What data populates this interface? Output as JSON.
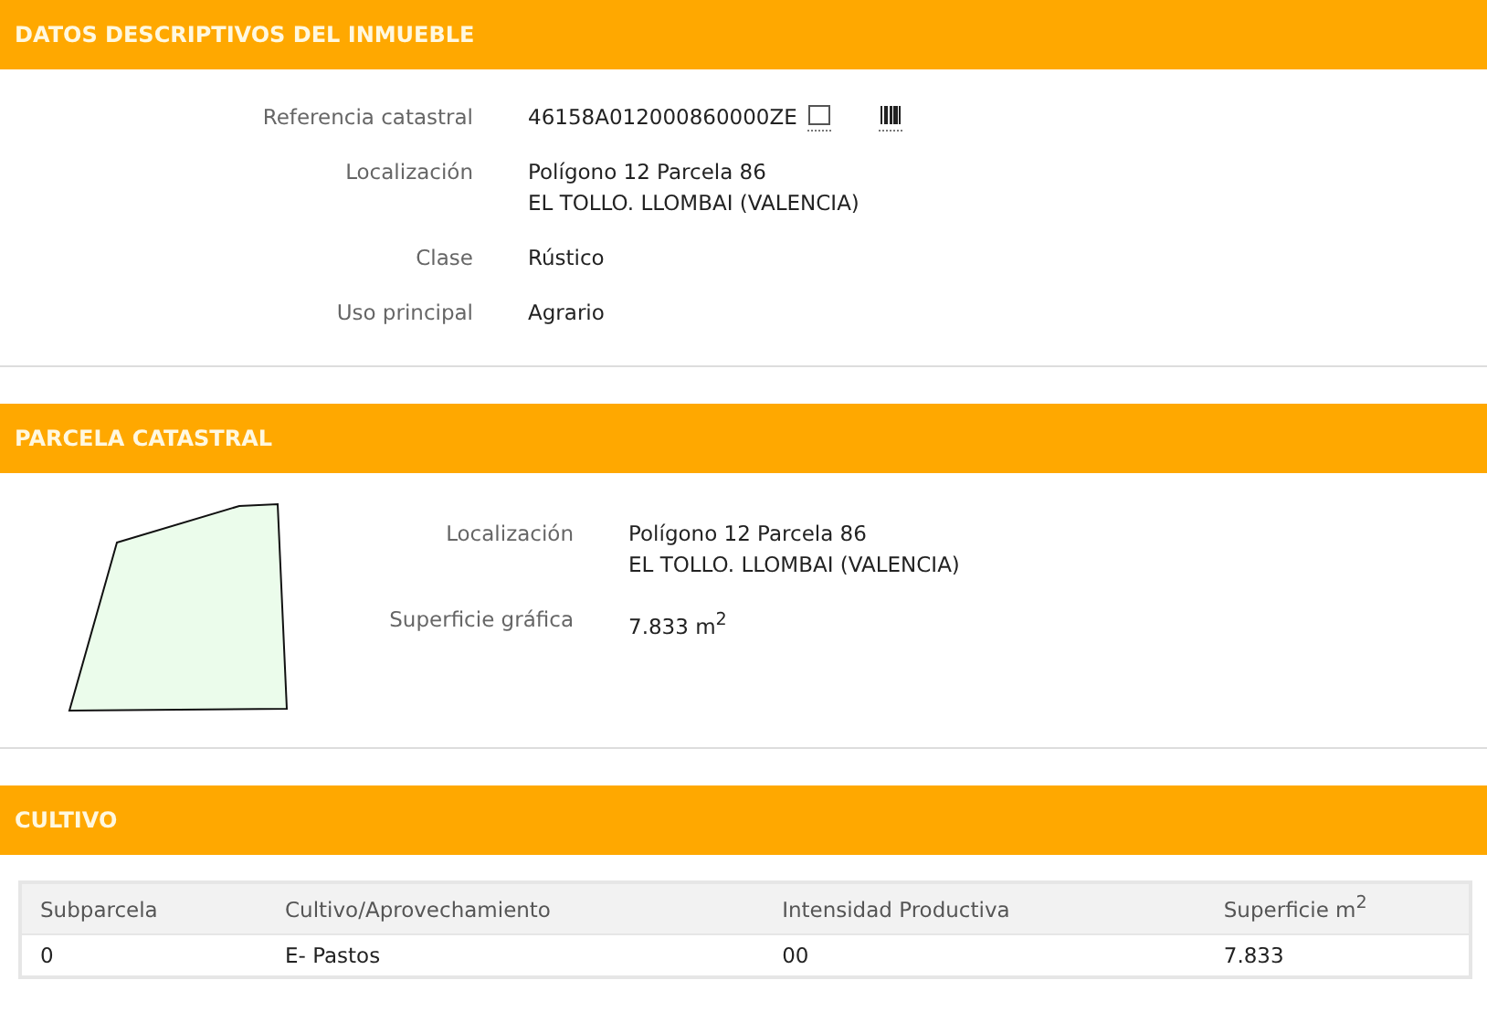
{
  "sections": [
    {
      "title": "DATOS DESCRIPTIVOS DEL INMUEBLE",
      "kind": "fields",
      "fields": [
        {
          "label": "Referencia catastral",
          "lines": [
            "46158A012000860000ZE"
          ],
          "icons": true
        },
        {
          "label": "Localización",
          "lines": [
            "Polígono 12 Parcela 86",
            "EL TOLLO. LLOMBAI (VALENCIA)"
          ]
        },
        {
          "label": "Clase",
          "lines": [
            "Rústico"
          ]
        },
        {
          "label": "Uso principal",
          "lines": [
            "Agrario"
          ]
        }
      ]
    },
    {
      "title": "PARCELA CATASTRAL",
      "kind": "parcel",
      "fields": [
        {
          "label": "Localización",
          "lines": [
            "Polígono 12 Parcela 86",
            "EL TOLLO. LLOMBAI (VALENCIA)"
          ]
        },
        {
          "label": "Superficie gráfica",
          "lines": [
            "7.833 m$^{2}$"
          ]
        }
      ]
    },
    {
      "title": "CULTIVO",
      "kind": "table",
      "columns": [
        "Subparcela",
        "Cultivo/Aprovechamiento",
        "Intensidad Productiva",
        "Superficie m$^{2}$"
      ],
      "rows": [
        [
          "0",
          "E- Pastos",
          "00",
          "7.833"
        ]
      ]
    }
  ]
}
